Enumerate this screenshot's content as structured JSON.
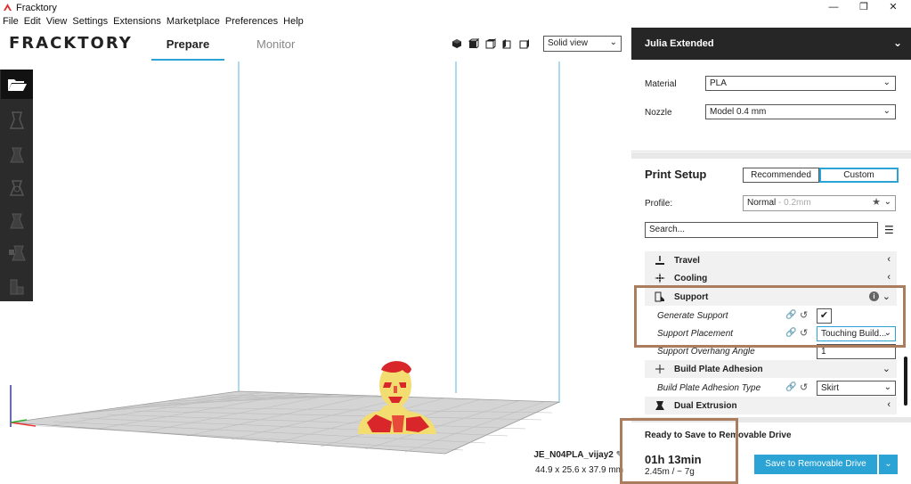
{
  "window": {
    "title": "Fracktory",
    "minimize": "—",
    "maximize": "❐",
    "close": "✕"
  },
  "menu": [
    "File",
    "Edit",
    "View",
    "Settings",
    "Extensions",
    "Marketplace",
    "Preferences",
    "Help"
  ],
  "header": {
    "logo": "FRACKTORY",
    "tab_prepare": "Prepare",
    "tab_monitor": "Monitor",
    "view_mode": "Solid view",
    "chevron": "⌄"
  },
  "file": {
    "name": "JE_N04PLA_vijay2",
    "dims": "44.9 x 25.6 x 37.9 mm"
  },
  "printer": {
    "name": "Julia Extended",
    "material_label": "Material",
    "material_value": "PLA",
    "nozzle_label": "Nozzle",
    "nozzle_value": "Model 0.4 mm"
  },
  "print_setup": {
    "title": "Print Setup",
    "recommended": "Recommended",
    "custom": "Custom",
    "profile_label": "Profile:",
    "profile_value": "Normal",
    "profile_sub": "- 0.2mm",
    "search_placeholder": "Search..."
  },
  "settings": {
    "travel": "Travel",
    "cooling": "Cooling",
    "support": "Support",
    "generate_support": "Generate Support",
    "support_placement": "Support Placement",
    "support_placement_value": "Touching Build...",
    "support_overhang": "Support Overhang Angle",
    "support_overhang_value": "1",
    "build_plate_adhesion": "Build Plate Adhesion",
    "adhesion_type": "Build Plate Adhesion Type",
    "adhesion_type_value": "Skirt",
    "dual_extrusion": "Dual Extrusion"
  },
  "output": {
    "status": "Ready to Save to Removable Drive",
    "time": "01h 13min",
    "material_use": "2.45m / ~ 7g",
    "save_button": "Save to Removable Drive"
  },
  "colors": {
    "accent": "#2ba3d4",
    "dark": "#262626",
    "annotation": "#a97d5d",
    "model_yellow": "#f3dc70",
    "model_red": "#d8262a"
  }
}
